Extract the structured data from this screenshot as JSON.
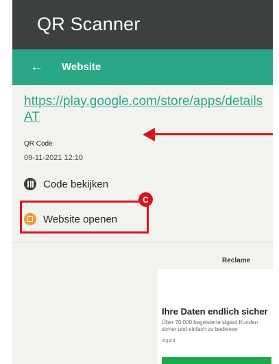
{
  "app": {
    "title": "QR Scanner"
  },
  "toolbar": {
    "back_icon": "back-arrow-icon",
    "title": "Website"
  },
  "result": {
    "url_line1": "https://play.google.com/store/apps/details",
    "url_line2": "AT",
    "type": "QR Code",
    "datetime": "09-11-2021 12:10"
  },
  "actions": {
    "view_code": {
      "label": "Code bekijken",
      "icon": "barcode-icon"
    },
    "open_website": {
      "label": "Website openen",
      "icon": "open-website-icon"
    }
  },
  "annotation": {
    "badge": "C",
    "color": "#d9131c"
  },
  "ad": {
    "label": "Reclame",
    "headline": "Ihre Daten endlich sicher",
    "body_line1": "Über 70.000 begeisterte idgard Kunden",
    "body_line2": "sicher und einfach zu bedienen",
    "brand": "idgard"
  },
  "colors": {
    "accent": "#2aa784",
    "statusbar": "#3c4041"
  }
}
